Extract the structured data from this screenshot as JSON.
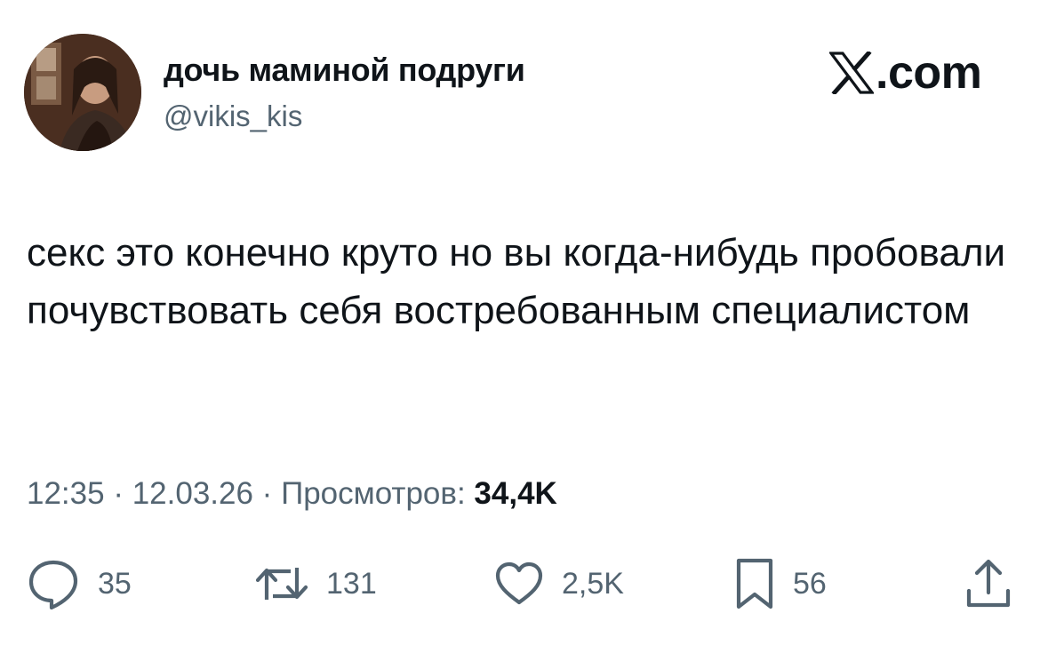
{
  "author": {
    "display_name": "дочь маминой подруги",
    "handle": "@vikis_kis"
  },
  "brand": {
    "suffix": ".com",
    "icon": "x-logo-icon"
  },
  "tweet": {
    "text": "секс это конечно круто но вы когда-нибудь пробовали почувствовать себя востребованным специалистом"
  },
  "meta": {
    "time": "12:35",
    "separator": " · ",
    "date": "12.03.26",
    "views_label": "Просмотров: ",
    "views_count": "34,4K"
  },
  "actions": {
    "replies": "35",
    "retweets": "131",
    "likes": "2,5K",
    "bookmarks": "56"
  },
  "colors": {
    "text": "#0f1419",
    "secondary": "#536471",
    "background": "#ffffff"
  }
}
